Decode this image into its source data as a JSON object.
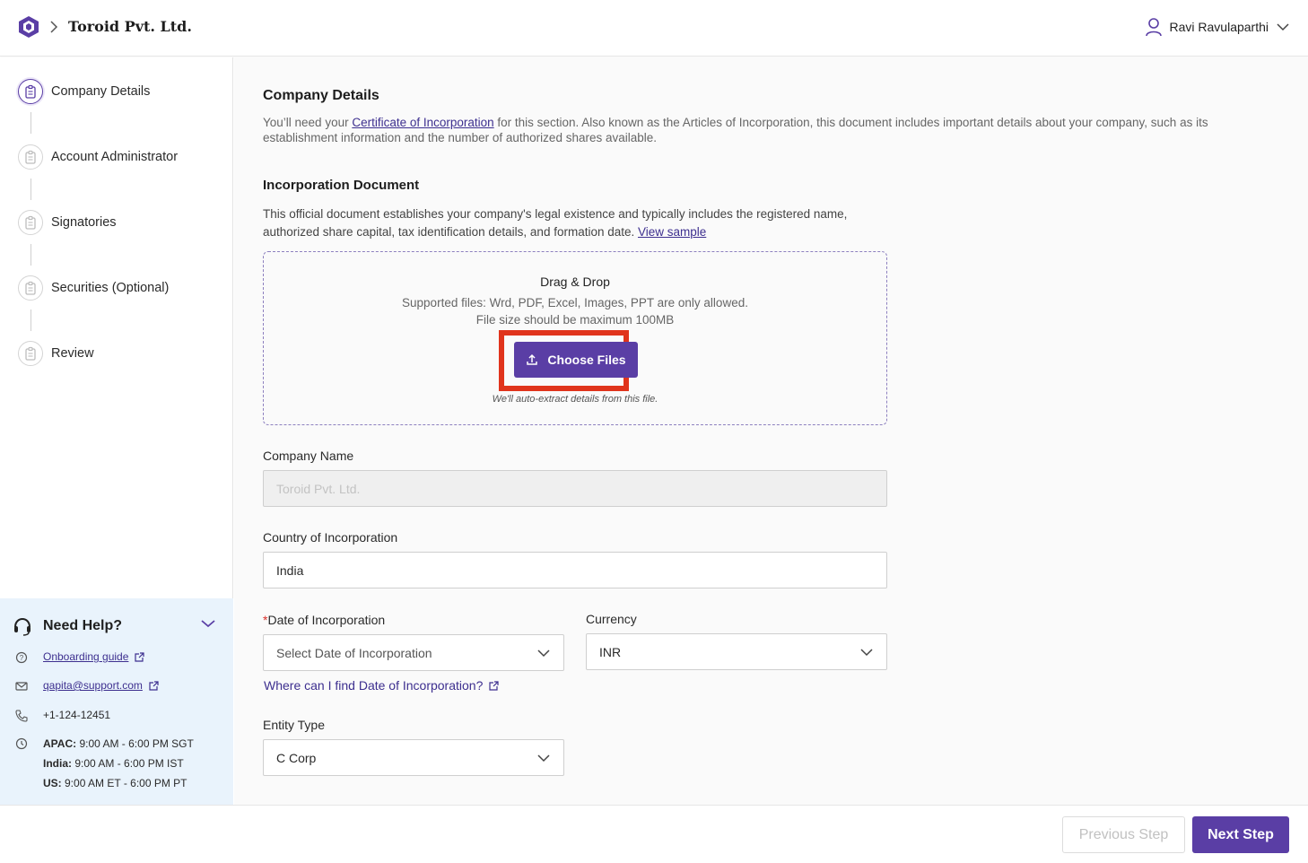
{
  "header": {
    "company": "Toroid Pvt. Ltd.",
    "user_name": "Ravi Ravulaparthi"
  },
  "sidebar": {
    "steps": [
      {
        "label": "Company Details",
        "active": true
      },
      {
        "label": "Account Administrator",
        "active": false
      },
      {
        "label": "Signatories",
        "active": false
      },
      {
        "label": "Securities (Optional)",
        "active": false
      },
      {
        "label": "Review",
        "active": false
      }
    ]
  },
  "help": {
    "title": "Need Help?",
    "guide": "Onboarding guide",
    "email": "qapita@support.com",
    "phone": "+1-124-12451",
    "hours": [
      {
        "region": "APAC:",
        "time": " 9:00 AM - 6:00 PM SGT"
      },
      {
        "region": "India:",
        "time": " 9:00 AM - 6:00 PM IST"
      },
      {
        "region": "US:",
        "time": " 9:00 AM ET - 6:00 PM PT"
      }
    ]
  },
  "main": {
    "title": "Company Details",
    "intro_pre": "You’ll need your ",
    "intro_link": "Certificate of Incorporation",
    "intro_post": " for this section. Also known as the Articles of Incorporation, this document includes important details about your company, such as its establishment information and the number of authorized shares available.",
    "doc_title": "Incorporation Document",
    "doc_desc": "This official document establishes your company's legal existence and typically includes the registered name, authorized share capital, tax identification details, and formation date. ",
    "doc_link": "View sample",
    "dropzone": {
      "title": "Drag & Drop",
      "supported": "Supported files: Wrd, PDF, Excel, Images, PPT are only allowed.",
      "size": "File size should be maximum 100MB",
      "button": "Choose Files",
      "note": "We'll auto-extract details from this file."
    },
    "company_name_label": "Company Name",
    "company_name_value": "Toroid Pvt. Ltd.",
    "country_label": "Country of Incorporation",
    "country_value": "India",
    "date_label": "Date of Incorporation",
    "date_placeholder": "Select Date of Incorporation",
    "date_help": "Where can I find Date of Incorporation?",
    "currency_label": "Currency",
    "currency_value": "INR",
    "entity_label": "Entity Type",
    "entity_value": "C Corp"
  },
  "footer": {
    "prev": "Previous Step",
    "next": "Next Step"
  },
  "colors": {
    "brand": "#5a3ea5",
    "highlight": "#e0341c",
    "help_bg": "#e9f3fc"
  }
}
